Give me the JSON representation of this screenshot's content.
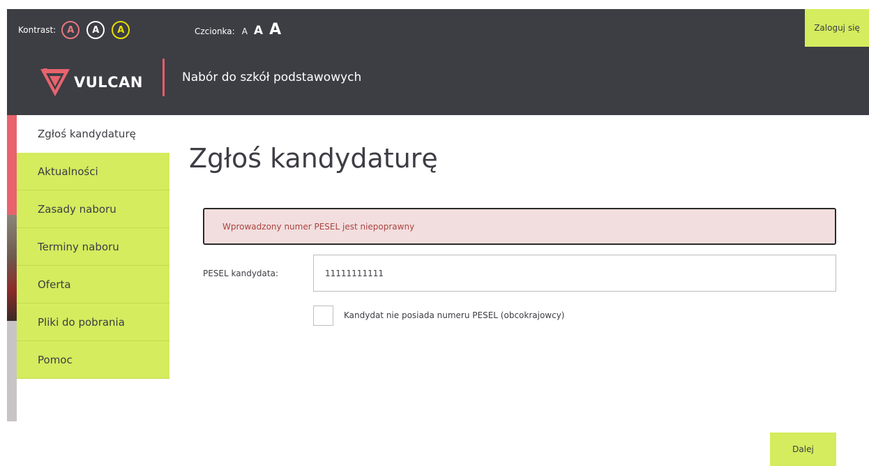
{
  "accessibility": {
    "contrast_label": "Kontrast:",
    "contrast_options": [
      "A",
      "A",
      "A"
    ],
    "font_label": "Czcionka:",
    "font_sizes": [
      "A",
      "A",
      "A"
    ]
  },
  "header": {
    "login_label": "Zaloguj się",
    "logo_text": "VULCAN",
    "app_title": "Nabór do szkół podstawowych"
  },
  "sidebar": {
    "items": [
      {
        "label": "Zgłoś kandydaturę",
        "active": true
      },
      {
        "label": "Aktualności"
      },
      {
        "label": "Zasady naboru"
      },
      {
        "label": "Terminy naboru"
      },
      {
        "label": "Oferta"
      },
      {
        "label": "Pliki do pobrania"
      },
      {
        "label": "Pomoc"
      }
    ]
  },
  "main": {
    "title": "Zgłoś kandydaturę",
    "alert_text": "Wprowadzony numer PESEL jest niepoprawny",
    "pesel_label": "PESEL kandydata:",
    "pesel_value": "11111111111",
    "no_pesel_checkbox_label": "Kandydat nie posiada numeru PESEL (obcokrajowcy)",
    "no_pesel_checked": false,
    "next_button": "Dalej"
  },
  "colors": {
    "header_bg": "#3d3d44",
    "accent_green": "#d4ec5e",
    "accent_red": "#e8636c",
    "alert_bg": "#f2dede",
    "alert_text": "#a94442"
  }
}
